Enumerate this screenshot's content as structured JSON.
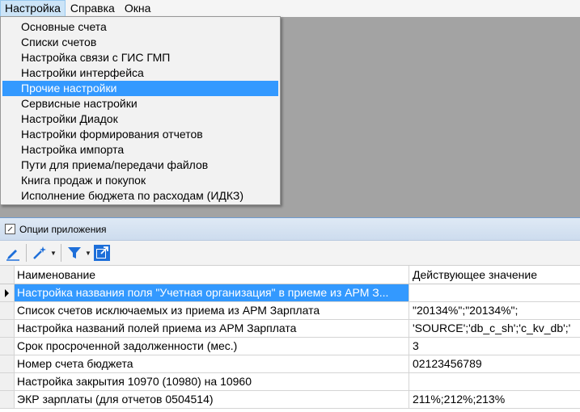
{
  "menubar": {
    "items": [
      "Настройка",
      "Справка",
      "Окна"
    ]
  },
  "dropdown": {
    "items": [
      "Основные счета",
      "Списки счетов",
      "Настройка связи с ГИС ГМП",
      "Настройки интерфейса",
      "Прочие настройки",
      "Сервисные настройки",
      "Настройки Диадок",
      "Настройки формирования отчетов",
      "Настройка импорта",
      "Пути для приема/передачи файлов",
      "Книга продаж и покупок",
      "Исполнение бюджета по расходам (ИДКЗ)"
    ],
    "selected_index": 4
  },
  "options_window": {
    "title": "Опции приложения"
  },
  "grid": {
    "columns": [
      "Наименование",
      "Действующее значение"
    ],
    "rows": [
      {
        "name": "Настройка названия поля \"Учетная организация\" в приеме из АРМ З...",
        "value": ""
      },
      {
        "name": "Список счетов исключаемых из приема из АРМ Зарплата",
        "value": "\"20134%\";\"20134%\";"
      },
      {
        "name": "Настройка названий полей приема из АРМ Зарплата",
        "value": "'SOURCE';'db_c_sh';'c_kv_db';'"
      },
      {
        "name": "Срок просроченной задолженности (мес.)",
        "value": "3"
      },
      {
        "name": "Номер счета бюджета",
        "value": "02123456789"
      },
      {
        "name": "Настройка закрытия 10970 (10980) на 10960",
        "value": ""
      },
      {
        "name": "ЭКР зарплаты (для отчетов 0504514)",
        "value": "211%;212%;213%"
      }
    ],
    "selected_row": 0
  },
  "colors": {
    "selection": "#3399ff",
    "mdi_background": "#a3a3a3"
  }
}
